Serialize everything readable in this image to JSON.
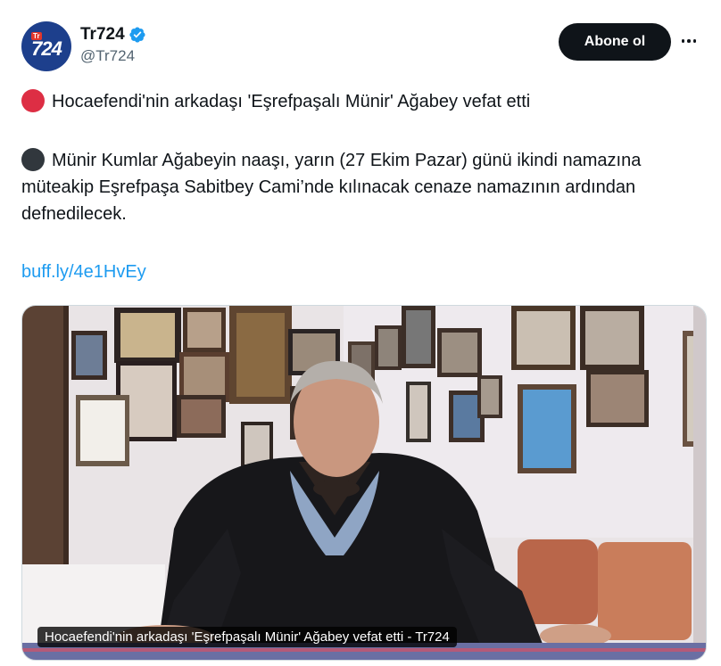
{
  "account": {
    "avatar_text": "724",
    "avatar_badge": "Tr",
    "display_name": "Tr724",
    "handle": "@Tr724",
    "verified_icon": "verified-badge-icon"
  },
  "actions": {
    "follow_label": "Abone ol",
    "more_icon": "more-dots-icon"
  },
  "tweet": {
    "headline": "Hocaefendi'nin arkadaşı 'Eşrefpaşalı Münir' Ağabey vefat etti",
    "headline_dot_color": "#dd2e44",
    "body": "Münir Kumlar Ağabeyin naaşı, yarın (27 Ekim Pazar) günü ikindi namazına müteakip Eşrefpaşa Sabitbey Cami’nde kılınacak cenaze namazının ardından defnedilecek.",
    "body_dot_color": "#31373d",
    "link": "buff.ly/4e1HvEy"
  },
  "media": {
    "caption": "Hocaefendi'nin arkadaşı 'Eşrefpaşalı Münir' Ağabey vefat etti - Tr724"
  },
  "colors": {
    "link": "#1d9bf0",
    "verified": "#1d9bf0",
    "button_bg": "#0f1419"
  }
}
